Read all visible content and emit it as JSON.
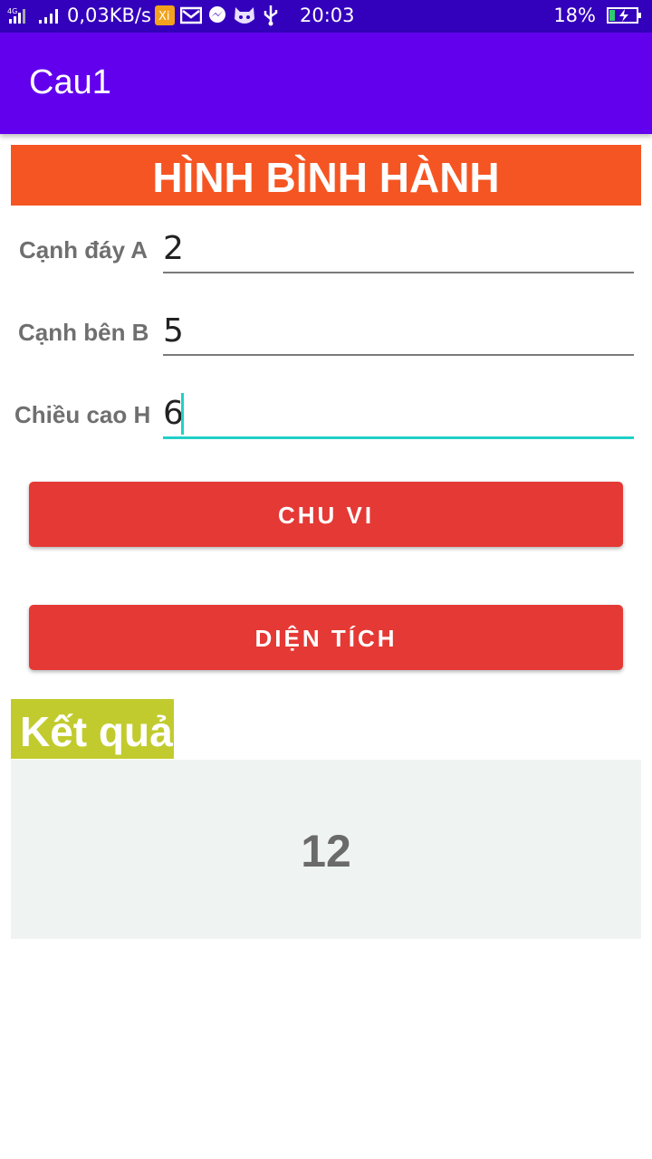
{
  "status_bar": {
    "network": "4G",
    "speed": "0,03KB/s",
    "time": "20:03",
    "battery": "18%",
    "icons": [
      "signal-icon",
      "signal-icon",
      "xiaomi-app-icon",
      "mail-icon",
      "messenger-icon",
      "cat-app-icon",
      "usb-icon",
      "battery-charging-icon"
    ]
  },
  "app_bar": {
    "title": "Cau1"
  },
  "banner": {
    "title": "HÌNH BÌNH HÀNH"
  },
  "form": {
    "fields": [
      {
        "label": "Cạnh đáy A",
        "value": "2"
      },
      {
        "label": "Cạnh bên B",
        "value": "5"
      },
      {
        "label": "Chiều cao H",
        "value": "6"
      }
    ]
  },
  "buttons": {
    "perimeter": "CHU VI",
    "area": "DIỆN TÍCH"
  },
  "result": {
    "label": "Kết quả",
    "value": "12"
  },
  "colors": {
    "status_bar": "#3300bb",
    "app_bar": "#6200ee",
    "banner": "#f55522",
    "button": "#e53935",
    "result_label": "#c2cb2e",
    "result_box": "#eff4f2",
    "focus": "#22d0c8"
  }
}
